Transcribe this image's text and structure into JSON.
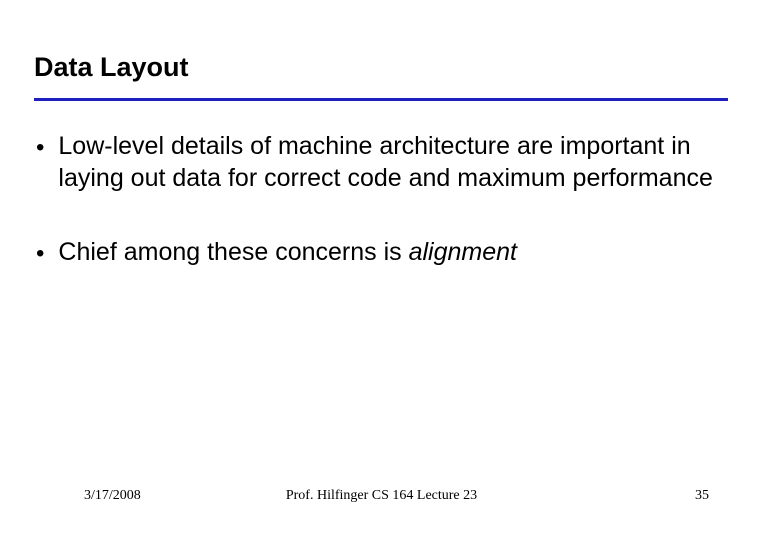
{
  "slide": {
    "title": "Data Layout",
    "bullets": [
      {
        "text": "Low-level details of machine architecture are important in laying out data for correct code and maximum performance"
      },
      {
        "prefix": "Chief among these concerns is ",
        "emph": "alignment"
      }
    ]
  },
  "footer": {
    "date": "3/17/2008",
    "center": "Prof. Hilfinger  CS 164  Lecture 23",
    "page": "35"
  }
}
